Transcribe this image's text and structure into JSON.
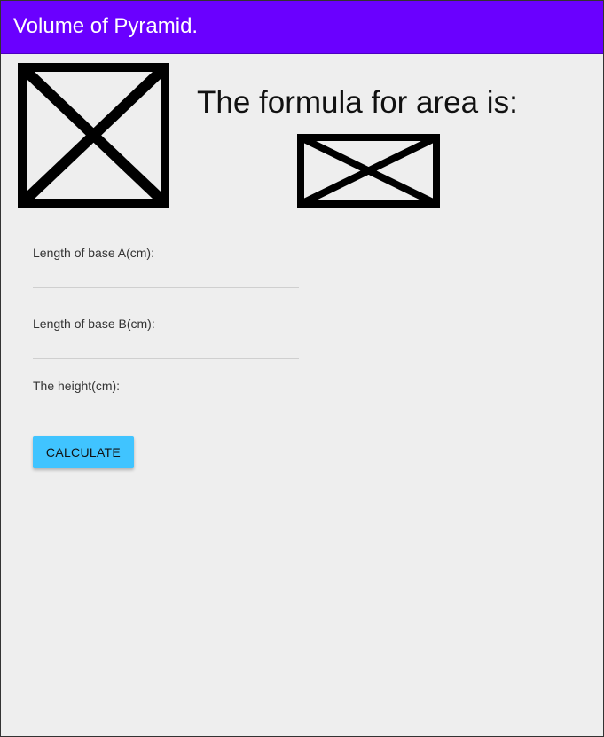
{
  "appbar": {
    "title": "Volume of Pyramid.",
    "background": "#6a00ff"
  },
  "images": {
    "main_image": "broken-image-placeholder",
    "formula_image": "broken-image-placeholder"
  },
  "formula": {
    "heading": "The formula for area is:"
  },
  "form": {
    "base_a": {
      "label": "Length of base A(cm):",
      "value": ""
    },
    "base_b": {
      "label": "Length of base B(cm):",
      "value": ""
    },
    "height": {
      "label": "The height(cm):",
      "value": ""
    }
  },
  "button": {
    "calculate_label": "CALCULATE",
    "background": "#40c4ff"
  },
  "colors": {
    "page_background": "#eeeeee",
    "appbar_text": "#ffffff"
  }
}
